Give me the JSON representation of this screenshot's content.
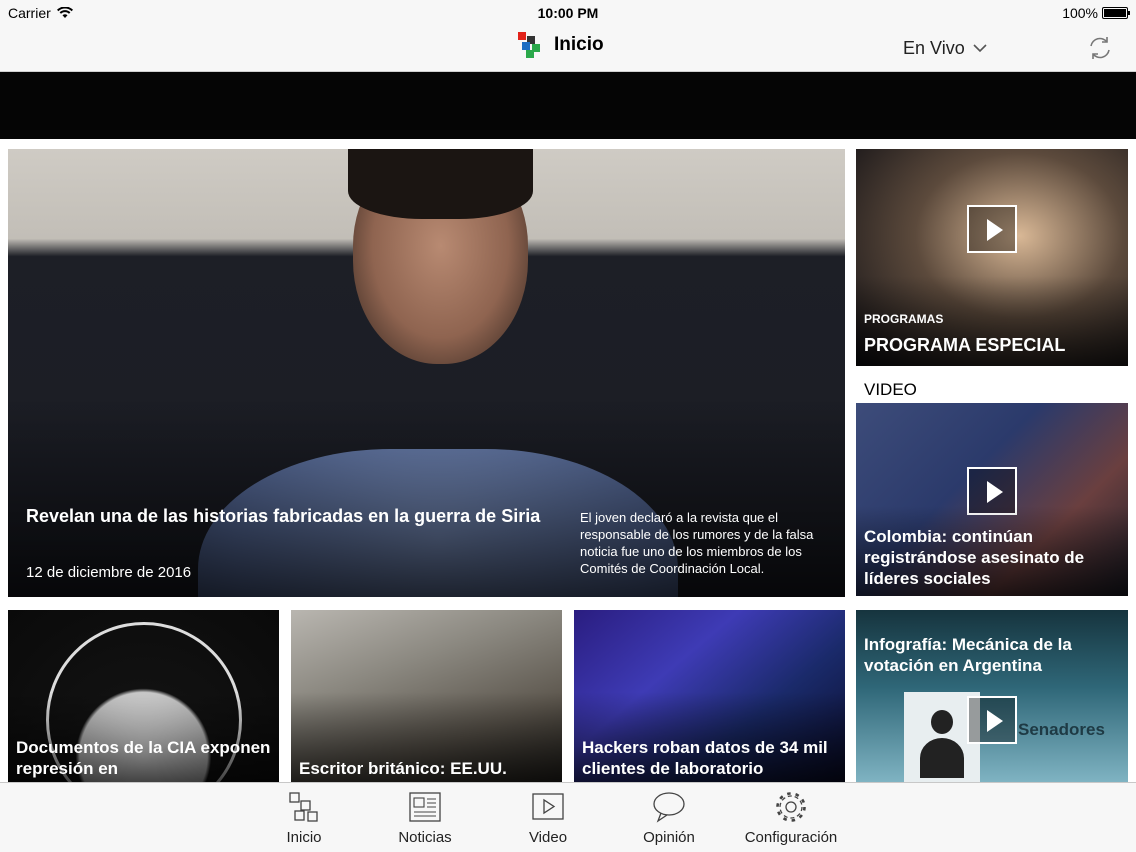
{
  "status_bar": {
    "carrier": "Carrier",
    "time": "10:00 PM",
    "battery": "100%",
    "battery_level": 1.0
  },
  "nav": {
    "title": "Inicio",
    "live_selector": "En Vivo",
    "refresh_icon": "refresh-icon"
  },
  "colors": {
    "logo_red": "#e2231a",
    "logo_green": "#2aa84a",
    "logo_blue": "#1b6cc2",
    "logo_dark": "#333333",
    "tab_icon": "#444444"
  },
  "hero": {
    "title": "Revelan una de las historias fabricadas en la guerra de Siria",
    "date": "12 de diciembre de 2016",
    "summary": "El joven declaró a la revista que el responsable de los rumores y de la falsa noticia fue uno de los miembros de los Comités de Coordinación Local."
  },
  "programa": {
    "category": "PROGRAMAS",
    "title": "PROGRAMA ESPECIAL"
  },
  "video_section": {
    "label": "VIDEO",
    "title": "Colombia: continúan registrándose asesinato de líderes sociales"
  },
  "infografia": {
    "title": "Infografía: Mecánica de la votación en Argentina",
    "overlay_text": "Senadores"
  },
  "cards": [
    {
      "title": "Documentos de la CIA exponen represión en"
    },
    {
      "title": "Escritor británico: EE.UU."
    },
    {
      "title": "Hackers roban datos de 34 mil clientes de laboratorio"
    }
  ],
  "tabs": [
    {
      "label": "Inicio",
      "icon": "home-network-icon"
    },
    {
      "label": "Noticias",
      "icon": "newspaper-icon"
    },
    {
      "label": "Video",
      "icon": "video-play-icon"
    },
    {
      "label": "Opinión",
      "icon": "speech-bubble-icon"
    },
    {
      "label": "Configuración",
      "icon": "gear-icon"
    }
  ]
}
